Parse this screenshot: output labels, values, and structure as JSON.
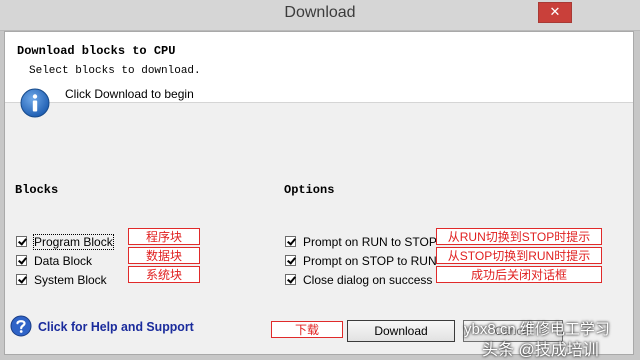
{
  "window": {
    "title": "Download",
    "close_glyph": "✕"
  },
  "header": {
    "title": "Download blocks to CPU",
    "subtitle": "Select blocks to download."
  },
  "info": {
    "icon": "info-icon",
    "text": "Click Download to begin"
  },
  "blocks": {
    "title": "Blocks",
    "items": [
      {
        "label": "Program Block",
        "checked": true,
        "annotation": "程序块"
      },
      {
        "label": "Data Block",
        "checked": true,
        "annotation": "数据块"
      },
      {
        "label": "System Block",
        "checked": true,
        "annotation": "系统块"
      }
    ]
  },
  "options": {
    "title": "Options",
    "items": [
      {
        "label": "Prompt on RUN to STOP",
        "checked": true,
        "annotation": "从RUN切换到STOP时提示"
      },
      {
        "label": "Prompt on STOP to RUN",
        "checked": true,
        "annotation": "从STOP切换到RUN时提示"
      },
      {
        "label": "Close dialog on success",
        "checked": true,
        "annotation": "成功后关闭对话框"
      }
    ]
  },
  "footer": {
    "help_icon": "help-icon",
    "help_text": "Click for Help and Support",
    "download_annotation": "下载",
    "download_label": "Download",
    "cancel_label": "Cancel"
  },
  "watermark": {
    "line1": "ybx8.cn 维修电工学习",
    "line2": "头条 @技成培训"
  },
  "colors": {
    "annotation_red": "#e02020",
    "help_blue": "#1a2b9c",
    "info_blue": "#1f5fb3"
  }
}
